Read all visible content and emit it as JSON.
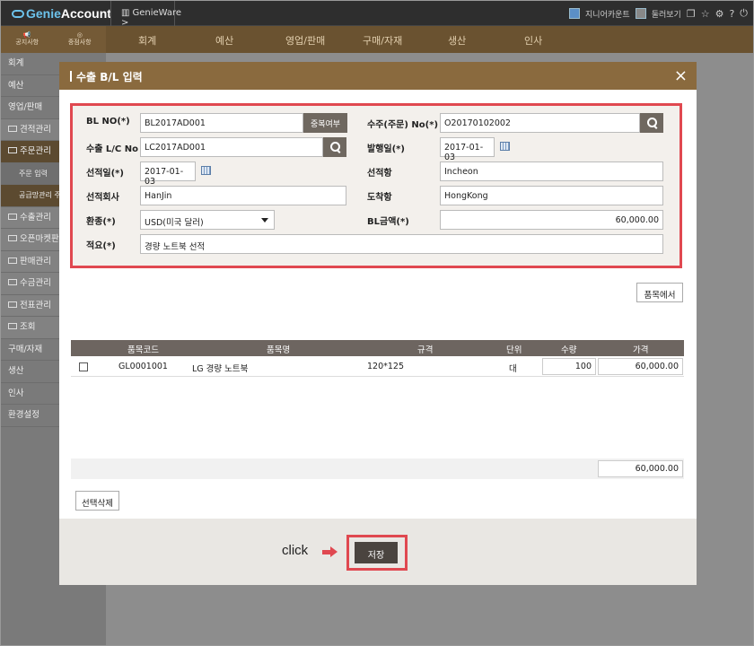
{
  "topbar": {
    "logo_prefix": "Genie",
    "logo_suffix": "Account",
    "app_name": "GenieWare",
    "app_arrow": ">",
    "link1": "지니어카운트",
    "link2": "둘러보기",
    "icons": [
      "window-icon",
      "star-icon",
      "gear-icon",
      "help-icon",
      "power-icon"
    ]
  },
  "nav": {
    "left": [
      "공지사항",
      "중점사항"
    ],
    "items": [
      "회계",
      "예산",
      "영업/판매",
      "구매/자재",
      "생산",
      "인사"
    ]
  },
  "sidebar": {
    "items": [
      {
        "label": "회계",
        "type": "top"
      },
      {
        "label": "예산",
        "type": "top"
      },
      {
        "label": "영업/판매",
        "type": "top"
      },
      {
        "label": "견적관리",
        "type": "group"
      },
      {
        "label": "주문관리",
        "type": "group-active"
      },
      {
        "label": "주문 입력",
        "type": "sub"
      },
      {
        "label": "공급망관리 주문",
        "type": "sub"
      },
      {
        "label": "수출관리",
        "type": "group"
      },
      {
        "label": "오픈마켓판매",
        "type": "group"
      },
      {
        "label": "판매관리",
        "type": "group"
      },
      {
        "label": "수금관리",
        "type": "group"
      },
      {
        "label": "전표관리",
        "type": "group"
      },
      {
        "label": "조회",
        "type": "group"
      },
      {
        "label": "구매/자재",
        "type": "top"
      },
      {
        "label": "생산",
        "type": "top"
      },
      {
        "label": "인사",
        "type": "top"
      },
      {
        "label": "환경설정",
        "type": "top"
      }
    ]
  },
  "modal": {
    "title": "수출 B/L 입력",
    "close": "×",
    "form": {
      "bl_no_label": "BL NO(*)",
      "bl_no_value": "BL2017AD001",
      "dup_check": "중복여부",
      "order_no_label": "수주(주문) No(*)",
      "order_no_value": "O20170102002",
      "lc_no_label": "수출 L/C No",
      "lc_no_value": "LC2017AD001",
      "issue_date_label": "발행일(*)",
      "issue_date_value": "2017-01-03",
      "ship_date_label": "선적일(*)",
      "ship_date_value": "2017-01-03",
      "ship_port_label": "선적항",
      "ship_port_value": "Incheon",
      "ship_company_label": "선적회사",
      "ship_company_value": "HanJin",
      "arrival_port_label": "도착항",
      "arrival_port_value": "HongKong",
      "currency_label": "환종(*)",
      "currency_value": "USD(미국 달러)",
      "bl_amount_label": "BL금액(*)",
      "bl_amount_value": "60,000.00",
      "remark_label": "적요(*)",
      "remark_value": "경량 노트북 선적"
    },
    "from_items_button": "품목에서",
    "table": {
      "headers": [
        "품목코드",
        "품목명",
        "규격",
        "단위",
        "수량",
        "가격"
      ],
      "rows": [
        {
          "code": "GL0001001",
          "name": "LG 경량 노트북",
          "spec": "120*125",
          "unit": "대",
          "qty": "100",
          "price": "60,000.00"
        }
      ],
      "total": "60,000.00"
    },
    "delete_selected": "선택삭제",
    "click_label": "click",
    "save_button": "저장"
  },
  "colors": {
    "accent_brown": "#8a6a3e",
    "highlight_red": "#e04850",
    "dark_button": "#6f6860"
  }
}
